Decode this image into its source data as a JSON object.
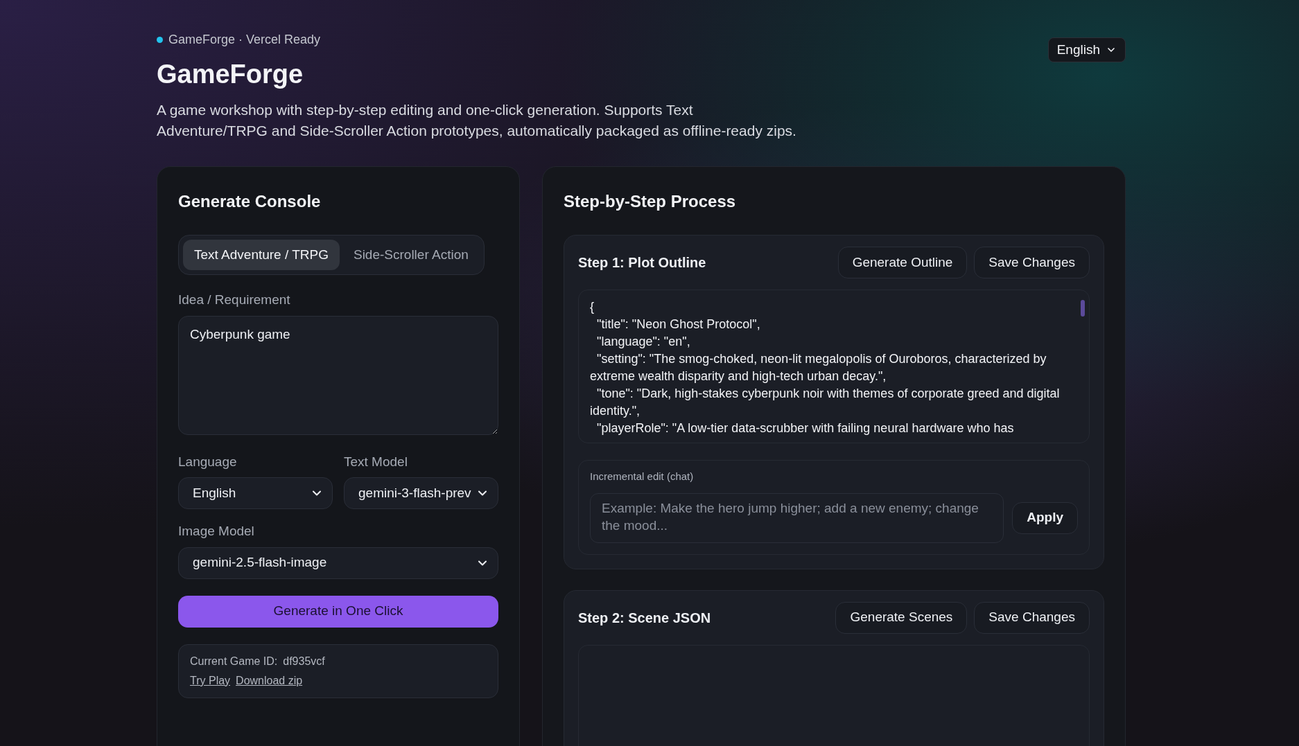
{
  "header": {
    "badge": "GameForge · Vercel Ready",
    "title": "GameForge",
    "description": "A game workshop with step-by-step editing and one-click generation. Supports Text Adventure/TRPG and Side-Scroller Action prototypes, automatically packaged as offline-ready zips.",
    "language_select": "English"
  },
  "console": {
    "title": "Generate Console",
    "tabs": [
      {
        "label": "Text Adventure / TRPG",
        "selected": true
      },
      {
        "label": "Side-Scroller Action",
        "selected": false
      }
    ],
    "idea": {
      "label": "Idea / Requirement",
      "value": "Cyberpunk game"
    },
    "language": {
      "label": "Language",
      "value": "English"
    },
    "text_model": {
      "label": "Text Model",
      "value": "gemini-3-flash-prev"
    },
    "image_model": {
      "label": "Image Model",
      "value": "gemini-2.5-flash-image"
    },
    "generate_button": "Generate in One Click",
    "info": {
      "game_id_label": "Current Game ID:",
      "game_id": "df935vcf",
      "links": [
        "Try Play",
        "Download zip"
      ]
    }
  },
  "process": {
    "title": "Step-by-Step Process",
    "steps": [
      {
        "title": "Step 1: Plot Outline",
        "buttons": [
          "Generate Outline",
          "Save Changes"
        ],
        "content": "{\n  \"title\": \"Neon Ghost Protocol\",\n  \"language\": \"en\",\n  \"setting\": \"The smog-choked, neon-lit megalopolis of Ouroboros, characterized by extreme wealth disparity and high-tech urban decay.\",\n  \"tone\": \"Dark, high-stakes cyberpunk noir with themes of corporate greed and digital identity.\",\n  \"playerRole\": \"A low-tier data-scrubber with failing neural hardware who has",
        "chat": {
          "label": "Incremental edit (chat)",
          "placeholder": "Example: Make the hero jump higher; add a new enemy; change the mood...",
          "button": "Apply"
        }
      },
      {
        "title": "Step 2: Scene JSON",
        "buttons": [
          "Generate Scenes",
          "Save Changes"
        ]
      }
    ]
  }
}
